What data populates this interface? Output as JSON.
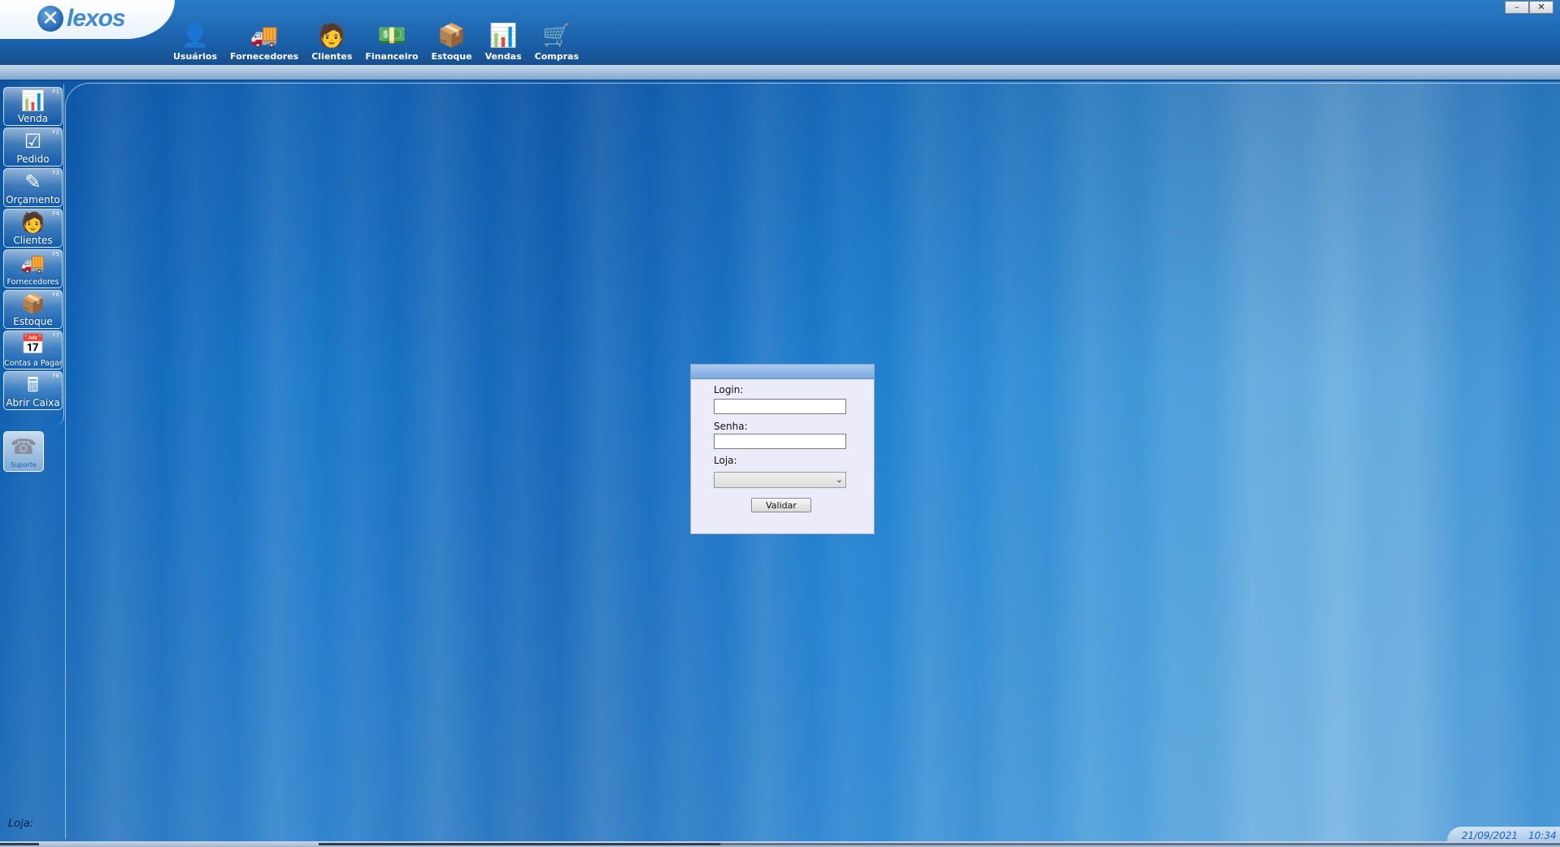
{
  "app": {
    "logo_text": "lexos",
    "window_controls": [
      "–",
      "✕"
    ]
  },
  "menu": {
    "items": [
      {
        "label": "Usuários",
        "icon": "user-icon"
      },
      {
        "label": "Fornecedores",
        "icon": "supplier-truck-icon"
      },
      {
        "label": "Clientes",
        "icon": "client-person-icon"
      },
      {
        "label": "Financeiro",
        "icon": "money-stack-icon"
      },
      {
        "label": "Estoque",
        "icon": "box-stack-icon"
      },
      {
        "label": "Vendas",
        "icon": "sales-chart-icon"
      },
      {
        "label": "Compras",
        "icon": "shopping-cart-icon"
      }
    ]
  },
  "sidebar": {
    "items": [
      {
        "label": "Venda",
        "key": "F1",
        "icon": "sales-chart-icon"
      },
      {
        "label": "Pedido",
        "key": "F2",
        "icon": "checklist-icon"
      },
      {
        "label": "Orçamento",
        "key": "F3",
        "icon": "paper-pen-icon"
      },
      {
        "label": "Clientes",
        "key": "F4",
        "icon": "client-person-icon"
      },
      {
        "label": "Fornecedores",
        "key": "F5",
        "icon": "supplier-truck-icon"
      },
      {
        "label": "Estoque",
        "key": "F6",
        "icon": "box-stack-icon"
      },
      {
        "label": "Contas a Pagar",
        "key": "F7",
        "icon": "calendar-icon"
      },
      {
        "label": "Abrir Caixa",
        "key": "F8",
        "icon": "cash-register-icon"
      }
    ],
    "support": {
      "label": "Suporte",
      "icon": "phone-icon"
    }
  },
  "login": {
    "login_label": "Login:",
    "login_value": "",
    "password_label": "Senha:",
    "password_value": "",
    "store_label": "Loja:",
    "store_value": "",
    "submit_label": "Validar"
  },
  "status": {
    "store_label": "Loja:",
    "date": "21/09/2021",
    "time": "10:34"
  }
}
